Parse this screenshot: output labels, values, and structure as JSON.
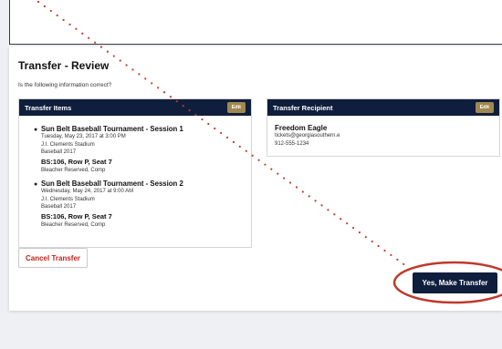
{
  "page": {
    "title": "Transfer - Review",
    "question": "Is the following information correct?"
  },
  "items_panel": {
    "title": "Transfer Items",
    "edit_label": "Edit",
    "items": [
      {
        "name": "Sun Belt Baseball Tournament - Session 1",
        "datetime": "Tuesday, May 23, 2017 at 3:00 PM",
        "venue": "J.I. Clements Stadium",
        "season": "Baseball 2017",
        "seat": "BS:106, Row P, Seat 7",
        "price_type": "Bleacher Reserved, Comp"
      },
      {
        "name": "Sun Belt Baseball Tournament - Session 2",
        "datetime": "Wednesday, May 24, 2017 at 9:00 AM",
        "venue": "J.I. Clements Stadium",
        "season": "Baseball 2017",
        "seat": "BS:106, Row P, Seat 7",
        "price_type": "Bleacher Reserved, Comp"
      }
    ]
  },
  "recipient_panel": {
    "title": "Transfer Recipient",
    "edit_label": "Edit",
    "name": "Freedom Eagle",
    "email": "tickets@georgiasouthern.e",
    "phone": "912-555-1234"
  },
  "actions": {
    "cancel_label": "Cancel Transfer",
    "confirm_label": "Yes, Make Transfer"
  },
  "annotation": {
    "dot_color": "#c0392b",
    "ellipse_color": "#c0392b"
  }
}
